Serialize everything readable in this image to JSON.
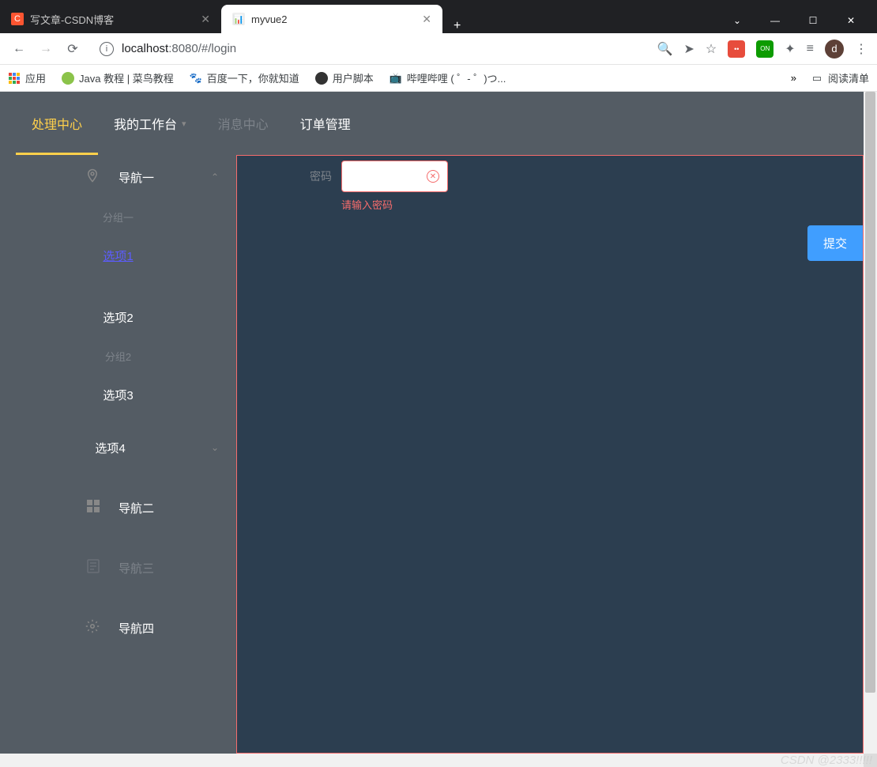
{
  "browser": {
    "tabs": [
      {
        "title": "写文章-CSDN博客",
        "icon": "C"
      },
      {
        "title": "myvue2",
        "icon": "🖼"
      }
    ],
    "win_chevron": "⌄",
    "win_min": "—",
    "win_max": "☐",
    "win_close": "✕",
    "url_host": "localhost",
    "url_port": ":8080",
    "url_path": "/#/login",
    "avatar_letter": "d"
  },
  "bookmarks": {
    "apps": "应用",
    "items": [
      "Java 教程 | 菜鸟教程",
      "百度一下，你就知道",
      "用户脚本",
      "哔哩哔哩 ( ゜- ゜)つ..."
    ],
    "reading_list": "阅读清单"
  },
  "top_menu": {
    "items": [
      {
        "label": "处理中心"
      },
      {
        "label": "我的工作台"
      },
      {
        "label": "消息中心"
      },
      {
        "label": "订单管理"
      }
    ]
  },
  "sidebar": {
    "nav1": {
      "label": "导航一"
    },
    "group1": "分组一",
    "opt1": "选项1",
    "opt2": "选项2",
    "group2": "分组2",
    "opt3": "选项3",
    "opt4": "选项4",
    "nav2": {
      "label": "导航二"
    },
    "nav3": {
      "label": "导航三"
    },
    "nav4": {
      "label": "导航四"
    }
  },
  "form": {
    "password_label": "密码",
    "password_error": "请输入密码",
    "submit": "提交"
  },
  "watermark": "CSDN @2333!!!!!"
}
